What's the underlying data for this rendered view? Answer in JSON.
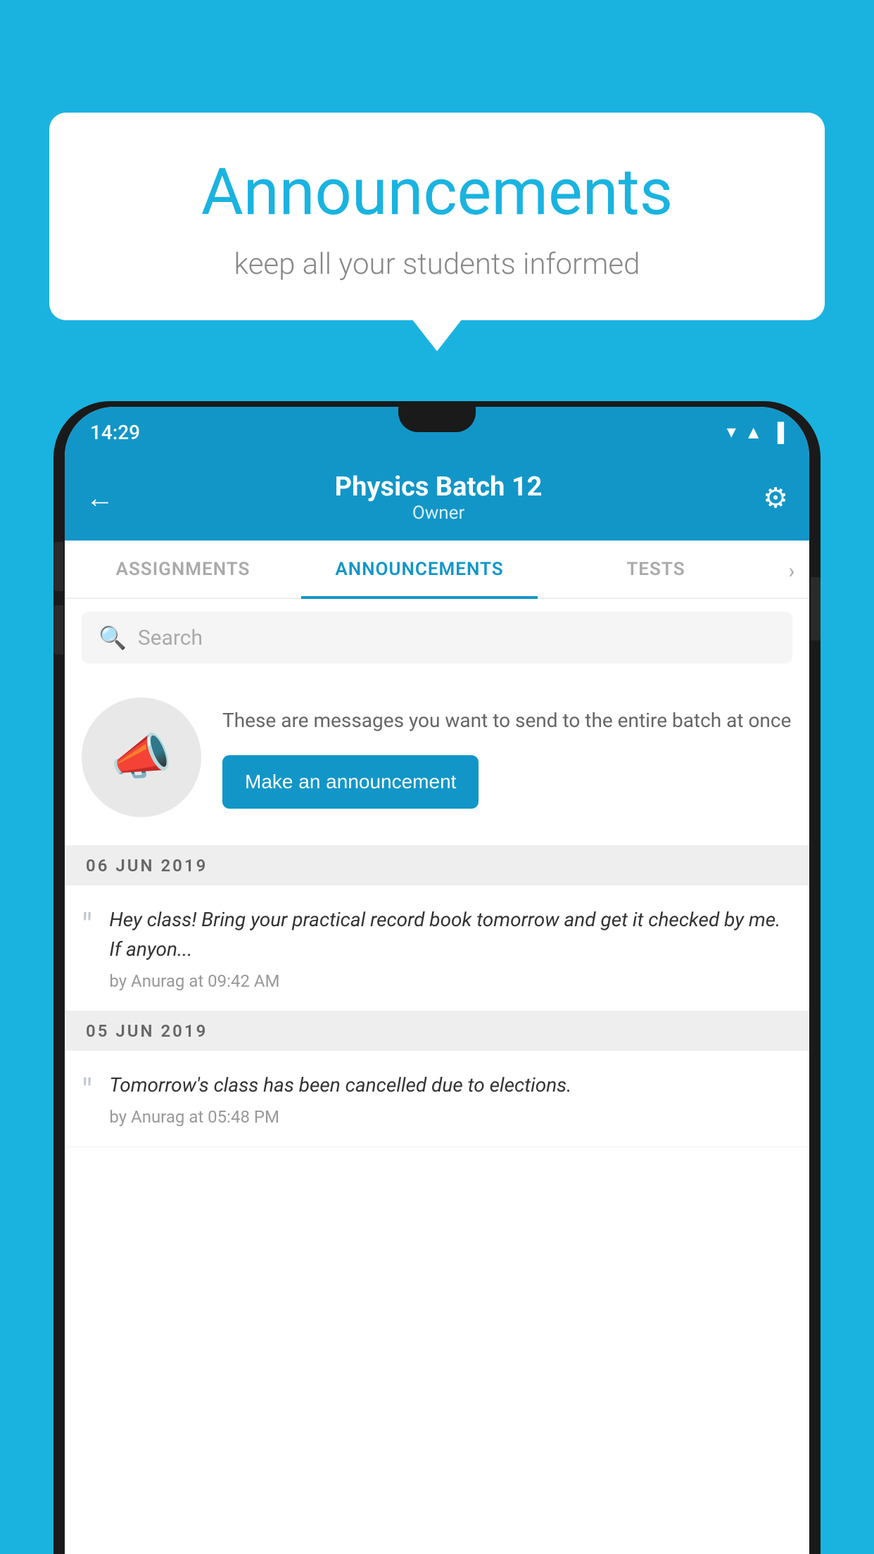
{
  "background_color": "#1ab3e0",
  "bubble": {
    "title": "Announcements",
    "subtitle": "keep all your students informed"
  },
  "status_bar": {
    "time": "14:29",
    "icons": [
      "▼◀▐"
    ]
  },
  "header": {
    "title": "Physics Batch 12",
    "subtitle": "Owner",
    "back_label": "←",
    "gear_label": "⚙"
  },
  "tabs": [
    {
      "label": "ASSIGNMENTS",
      "active": false
    },
    {
      "label": "ANNOUNCEMENTS",
      "active": true
    },
    {
      "label": "TESTS",
      "active": false
    }
  ],
  "search": {
    "placeholder": "Search"
  },
  "prompt": {
    "text": "These are messages you want to send to the entire batch at once",
    "button_label": "Make an announcement"
  },
  "announcements": [
    {
      "date": "06  JUN  2019",
      "text": "Hey class! Bring your practical record book tomorrow and get it checked by me. If anyon...",
      "author": "by Anurag at 09:42 AM"
    },
    {
      "date": "05  JUN  2019",
      "text": "Tomorrow's class has been cancelled due to elections.",
      "author": "by Anurag at 05:48 PM"
    }
  ]
}
